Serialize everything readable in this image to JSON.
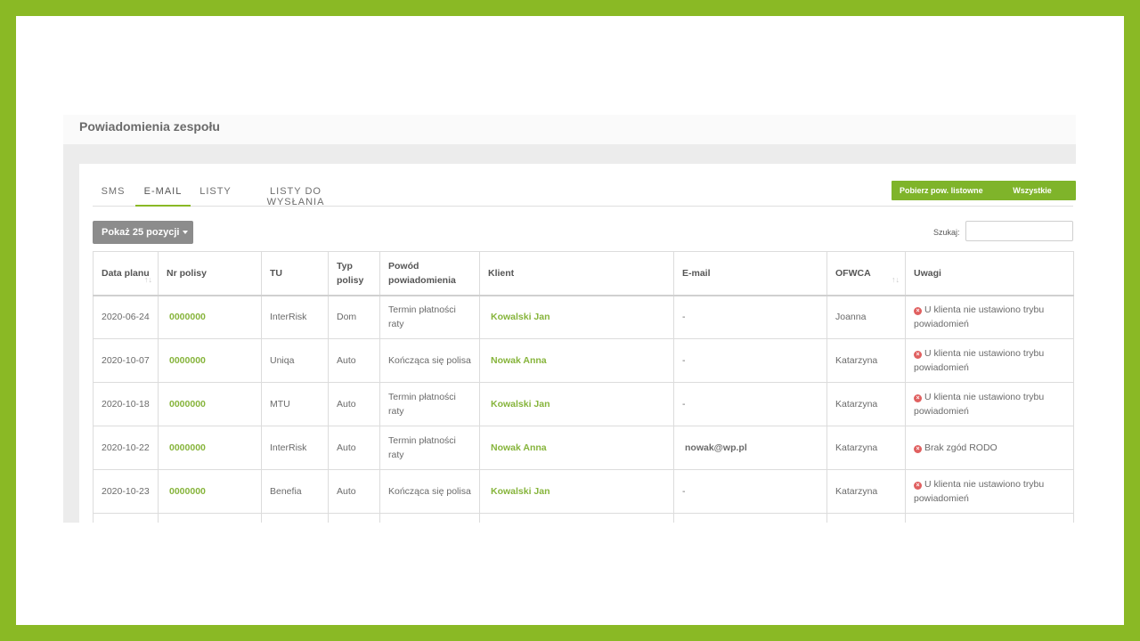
{
  "panel": {
    "title": "Powiadomienia zespołu"
  },
  "tabs": [
    "SMS",
    "E-MAIL",
    "LISTY",
    "LISTY DO WYSŁANIA"
  ],
  "active_tab": "E-MAIL",
  "actions": {
    "download": "Pobierz pow. listowne",
    "all_sent": "Wszystkie wysłane"
  },
  "show_entries": "Pokaż 25 pozycji",
  "search": {
    "label": "Szukaj:",
    "value": ""
  },
  "columns": [
    "Data planu",
    "Nr polisy",
    "TU",
    "Typ polisy",
    "Powód powiadomienia",
    "Klient",
    "E-mail",
    "OFWCA",
    "Uwagi"
  ],
  "rows": [
    {
      "date": "2020-06-24",
      "policy": "0000000",
      "tu": "InterRisk",
      "type": "Dom",
      "reason": "Termin płatności raty",
      "client": "Kowalski Jan",
      "email": "-",
      "ofwca": "Joanna",
      "note": "U klienta nie ustawiono trybu powiadomień"
    },
    {
      "date": "2020-10-07",
      "policy": "0000000",
      "tu": "Uniqa",
      "type": "Auto",
      "reason": "Kończąca się polisa",
      "client": "Nowak Anna",
      "email": "-",
      "ofwca": "Katarzyna",
      "note": "U klienta nie ustawiono trybu powiadomień"
    },
    {
      "date": "2020-10-18",
      "policy": "0000000",
      "tu": "MTU",
      "type": "Auto",
      "reason": "Termin płatności raty",
      "client": "Kowalski Jan",
      "email": "-",
      "ofwca": "Katarzyna",
      "note": "U klienta nie ustawiono trybu powiadomień"
    },
    {
      "date": "2020-10-22",
      "policy": "0000000",
      "tu": "InterRisk",
      "type": "Auto",
      "reason": "Termin płatności raty",
      "client": "Nowak Anna",
      "email": "nowak@wp.pl",
      "ofwca": "Katarzyna",
      "note": "Brak zgód RODO"
    },
    {
      "date": "2020-10-23",
      "policy": "0000000",
      "tu": "Benefia",
      "type": "Auto",
      "reason": "Kończąca się polisa",
      "client": "Kowalski Jan",
      "email": "-",
      "ofwca": "Katarzyna",
      "note": "U klienta nie ustawiono trybu powiadomień"
    }
  ],
  "colors": {
    "accent": "#8ab925",
    "error": "#e06060"
  },
  "icons": {
    "sort": "sort-arrows-icon",
    "error": "error-circle-icon"
  }
}
